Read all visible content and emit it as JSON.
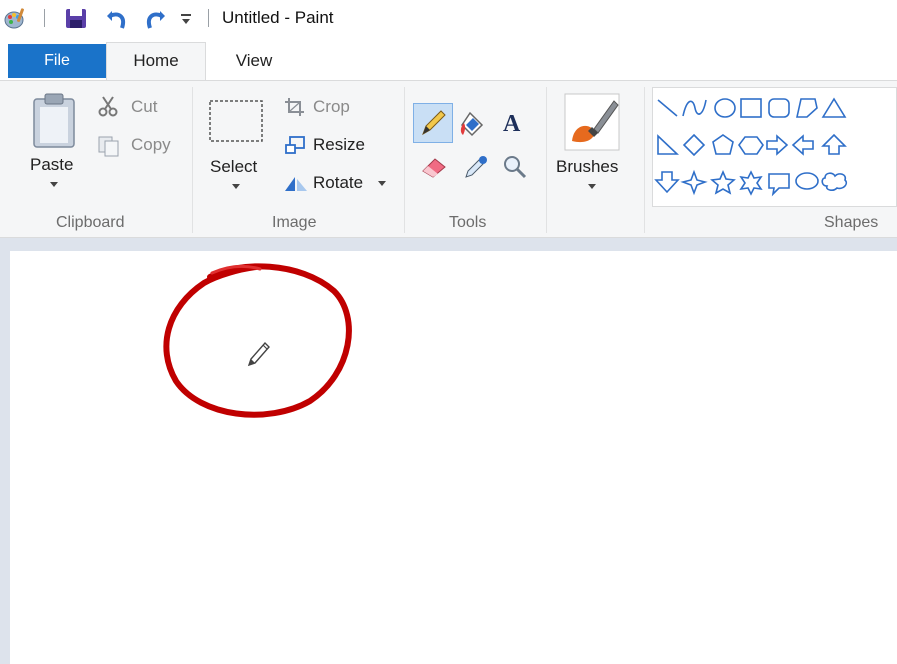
{
  "window": {
    "title": "Untitled - Paint"
  },
  "quick_access": {
    "app_icon": "paint-palette-icon",
    "save_icon": "save-icon",
    "undo_icon": "undo-icon",
    "redo_icon": "redo-icon",
    "customize_icon": "customize-dropdown-icon"
  },
  "tabs": [
    {
      "label": "File"
    },
    {
      "label": "Home"
    },
    {
      "label": "View"
    }
  ],
  "groups": {
    "clipboard": {
      "label": "Clipboard",
      "paste": "Paste",
      "cut": "Cut",
      "copy": "Copy"
    },
    "image": {
      "label": "Image",
      "select": "Select",
      "crop": "Crop",
      "resize": "Resize",
      "rotate": "Rotate"
    },
    "tools": {
      "label": "Tools"
    },
    "brushes": {
      "label": "Brushes"
    },
    "shapes": {
      "label": "Shapes"
    }
  },
  "colors": {
    "file_tab": "#1a73c9",
    "ribbon_bg": "#f5f6f7",
    "annotation": "#c00000"
  }
}
